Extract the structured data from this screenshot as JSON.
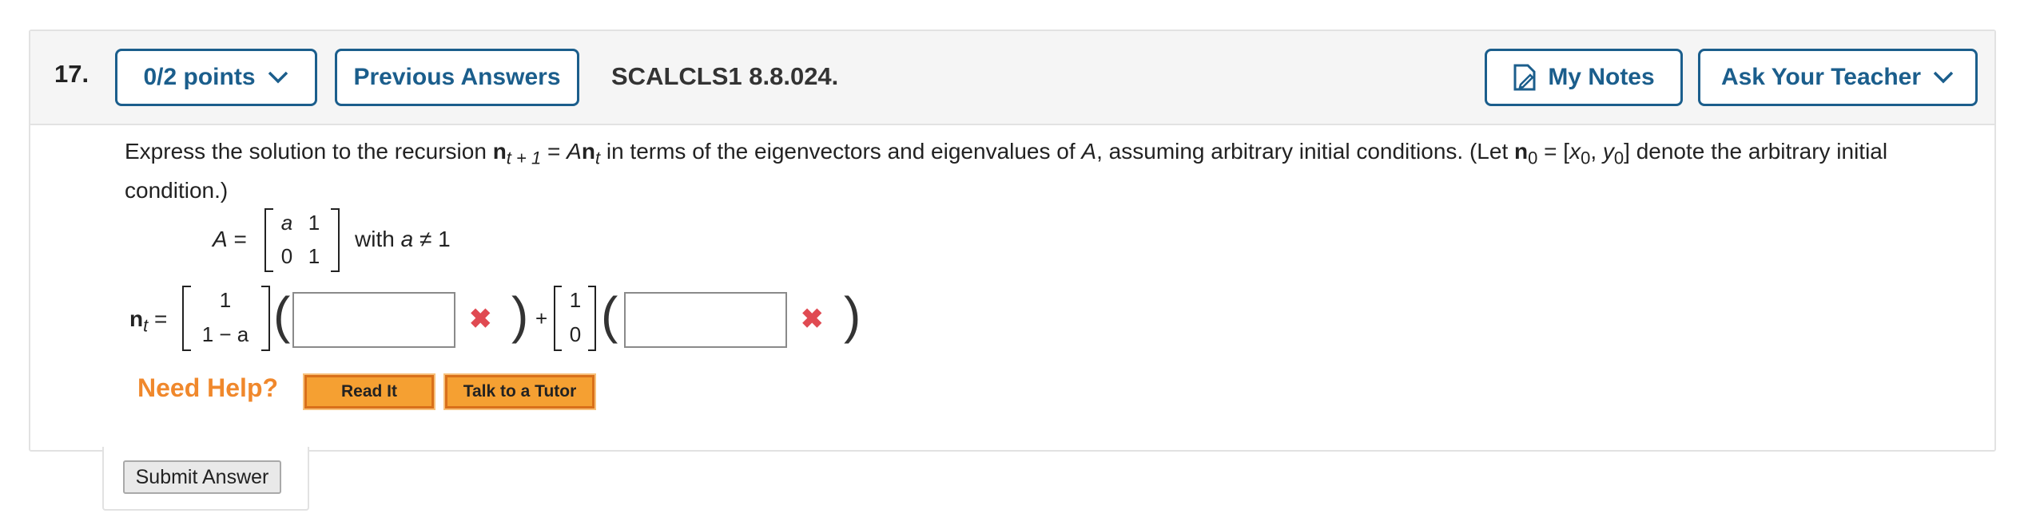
{
  "header": {
    "question_number": "17.",
    "points_label": "0/2 points",
    "previous_answers_label": "Previous Answers",
    "question_ref": "SCALCLS1 8.8.024.",
    "my_notes_label": "My Notes",
    "ask_teacher_label": "Ask Your Teacher"
  },
  "stem": {
    "p1": "Express the solution to the recursion ",
    "n1": "n",
    "sub1": "t + 1",
    "eq": " = ",
    "A": "A",
    "n2": "n",
    "sub2": "t",
    "p2": " in terms of the eigenvectors and eigenvalues of ",
    "A2": "A",
    "p3": ", assuming arbitrary initial conditions. (Let ",
    "n3": "n",
    "sub3": "0",
    "p4": " = [",
    "x0": "x",
    "x0sub": "0",
    "comma": ", ",
    "y0": "y",
    "y0sub": "0",
    "p5": "]  denote the arbitrary initial condition.)"
  },
  "matrix": {
    "label_A": "A",
    "label_eq": "=",
    "cells": [
      "a",
      "1",
      "0",
      "1"
    ],
    "condition_text": "with",
    "condition_var": "a",
    "condition_rel": "≠ 1"
  },
  "answer": {
    "lhs_n": "n",
    "lhs_sub": "t",
    "lhs_eq": "=",
    "vec1": [
      "1",
      "1 − a"
    ],
    "plus": "+",
    "vec2": [
      "1",
      "0"
    ],
    "box1_value": "",
    "box2_value": "",
    "status": "incorrect",
    "open_paren": "(",
    "close_paren": ")"
  },
  "help": {
    "need_help": "Need Help?",
    "read_it": "Read It",
    "talk_to_tutor": "Talk to a Tutor"
  },
  "submit_label": "Submit Answer",
  "colors": {
    "accent_blue": "#1b5e8c",
    "error_red": "#e04a52",
    "help_orange": "#f0882c",
    "button_orange": "#f5a032"
  }
}
